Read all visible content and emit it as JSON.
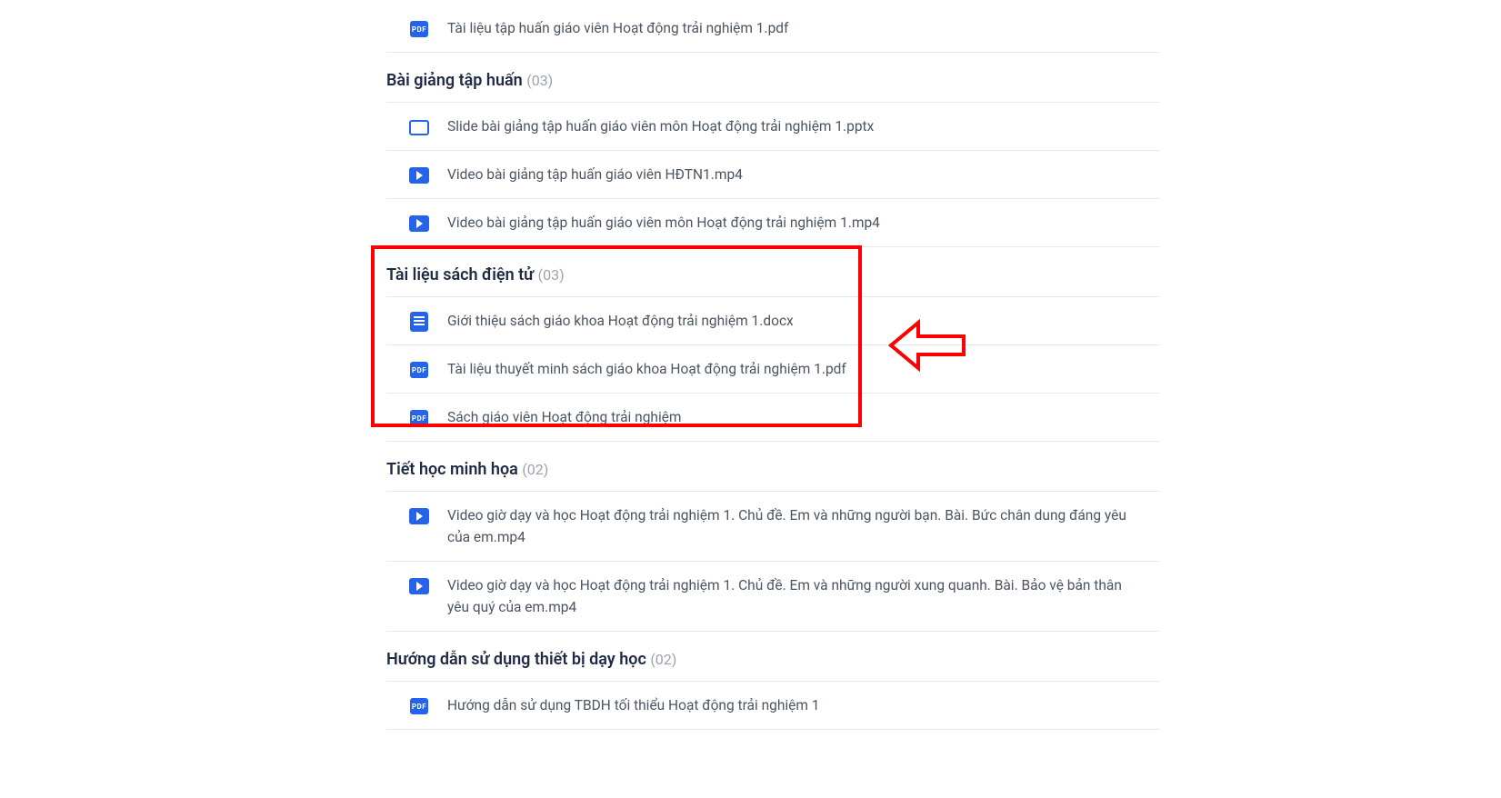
{
  "sections": [
    {
      "items": [
        {
          "iconType": "pdf",
          "label": "Tài liệu tập huấn giáo viên Hoạt động trải nghiệm 1.pdf"
        }
      ]
    },
    {
      "title": "Bài giảng tập huấn",
      "count": "(03)",
      "items": [
        {
          "iconType": "slide",
          "label": "Slide bài giảng tập huấn giáo viên môn Hoạt động trải nghiệm 1.pptx"
        },
        {
          "iconType": "video",
          "label": "Video bài giảng tập huấn giáo viên HĐTN1.mp4"
        },
        {
          "iconType": "video",
          "label": "Video bài giảng tập huấn giáo viên môn Hoạt động trải nghiệm 1.mp4"
        }
      ]
    },
    {
      "title": "Tài liệu sách điện tử",
      "count": "(03)",
      "items": [
        {
          "iconType": "doc",
          "label": "Giới thiệu sách giáo khoa Hoạt động trải nghiệm 1.docx"
        },
        {
          "iconType": "pdf",
          "label": "Tài liệu thuyết minh sách giáo khoa Hoạt động trải nghiệm 1.pdf"
        },
        {
          "iconType": "pdf",
          "label": "Sách giáo viên Hoạt động trải nghiệm"
        }
      ]
    },
    {
      "title": "Tiết học minh họa",
      "count": "(02)",
      "items": [
        {
          "iconType": "video",
          "label": "Video giờ dạy và học Hoạt động trải nghiệm 1. Chủ đề. Em và những người bạn. Bài. Bức chân dung đáng yêu của em.mp4"
        },
        {
          "iconType": "video",
          "label": "Video giờ dạy và học Hoạt động trải nghiệm 1. Chủ đề. Em và những người xung quanh. Bài. Bảo vệ bản thân yêu quý của em.mp4"
        }
      ]
    },
    {
      "title": "Hướng dẫn sử dụng thiết bị dạy học",
      "count": "(02)",
      "items": [
        {
          "iconType": "pdf",
          "label": "Hướng dẫn sử dụng TBDH tối thiểu Hoạt động trải nghiệm 1"
        }
      ]
    }
  ],
  "iconLabels": {
    "pdf": "PDF"
  }
}
